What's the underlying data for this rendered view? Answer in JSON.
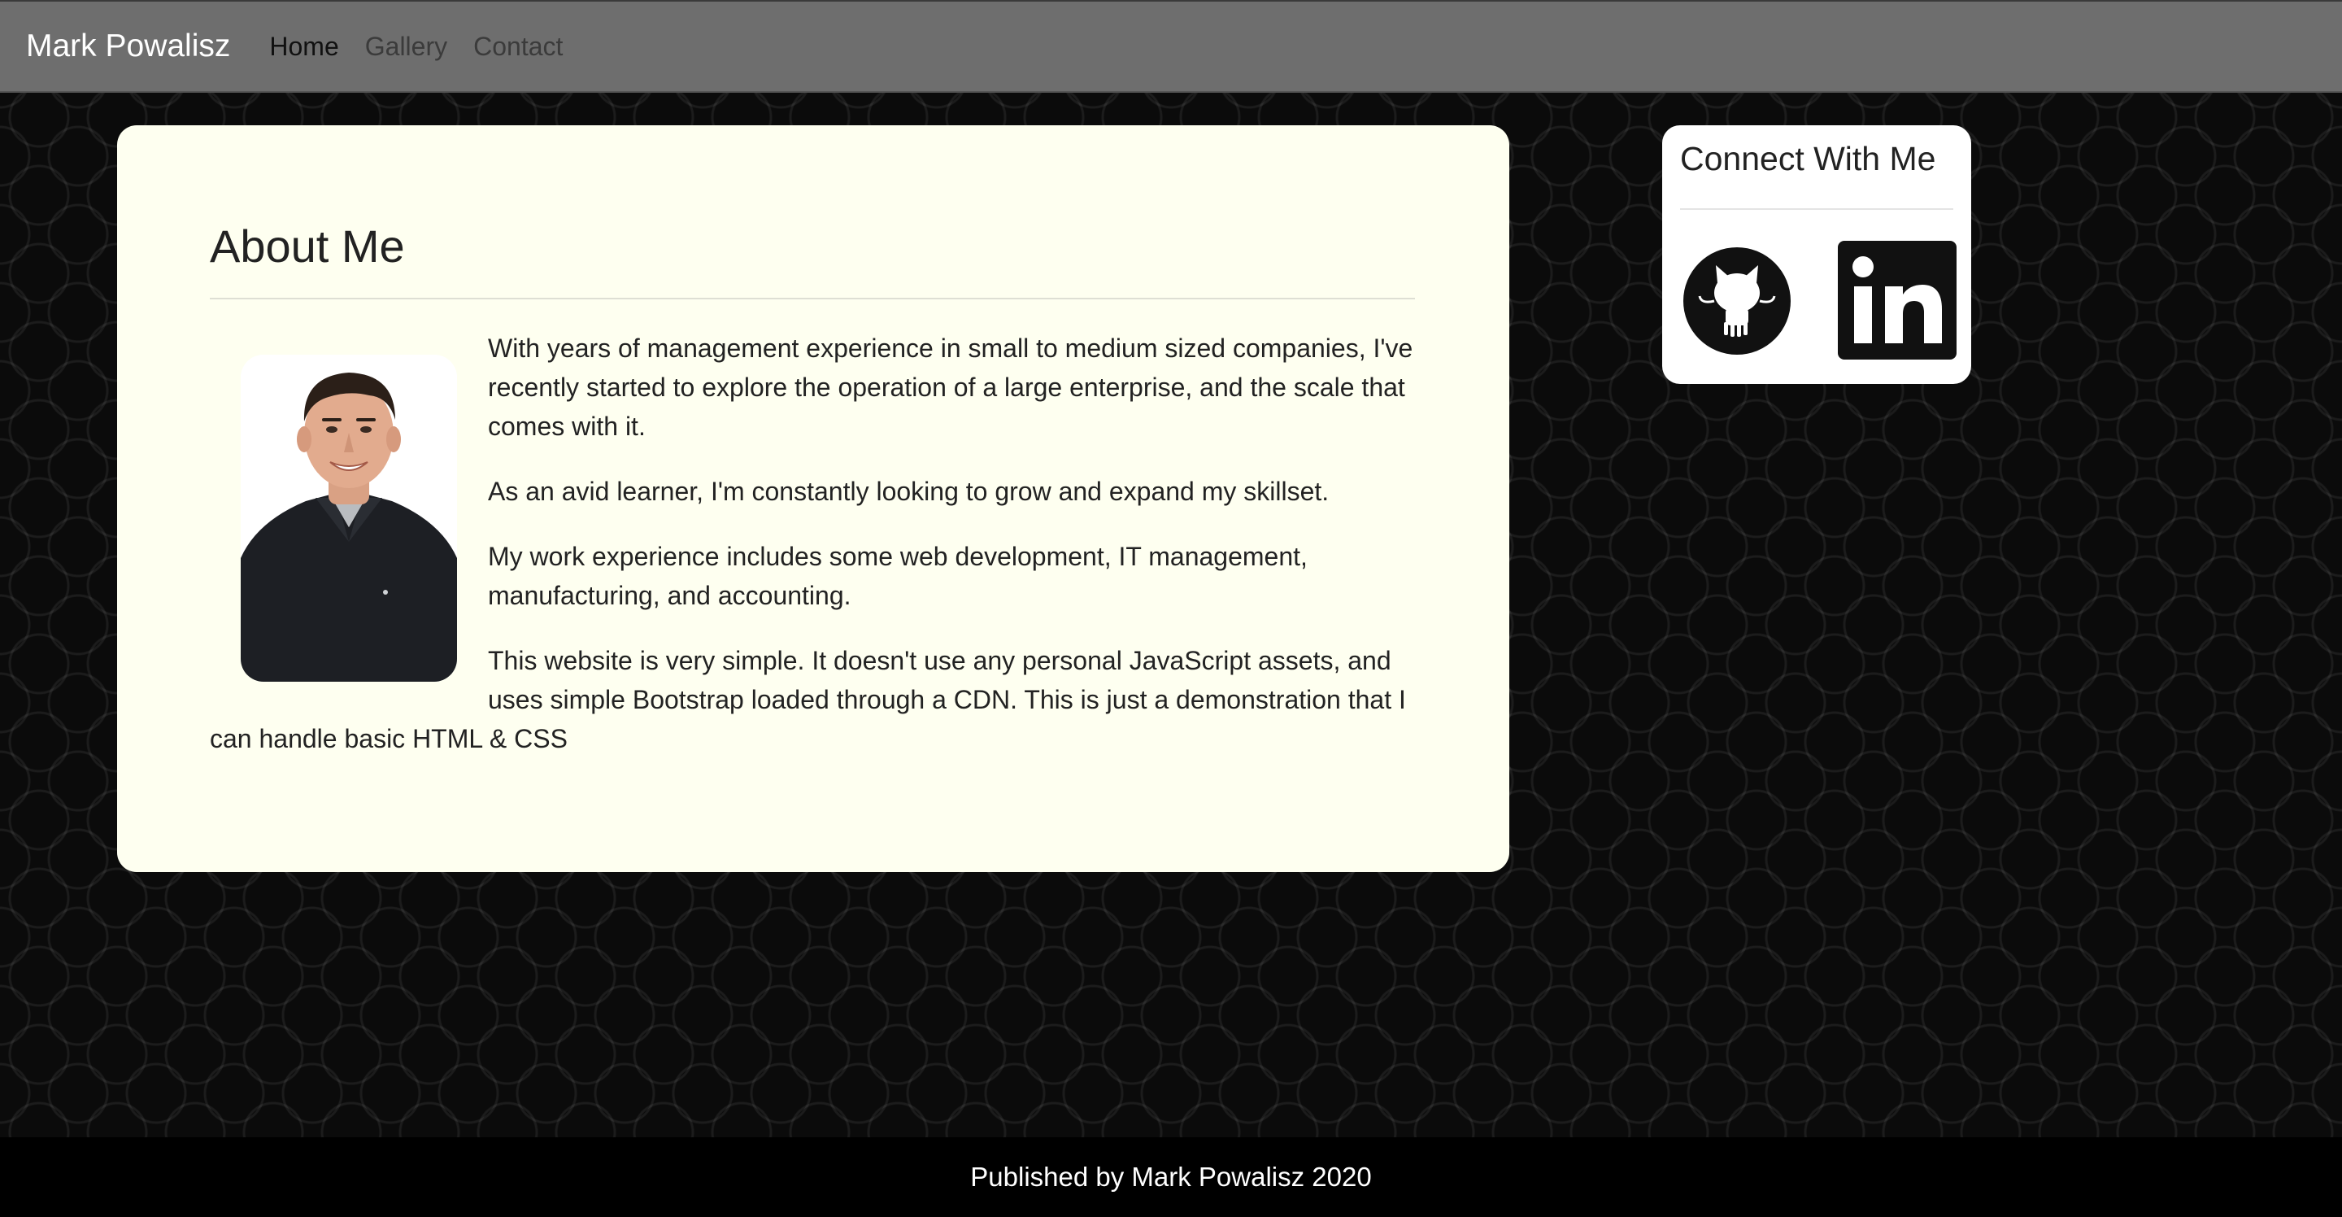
{
  "navbar": {
    "brand": "Mark Powalisz",
    "links": [
      {
        "label": "Home",
        "active": true
      },
      {
        "label": "Gallery",
        "active": false
      },
      {
        "label": "Contact",
        "active": false
      }
    ]
  },
  "about": {
    "title": "About Me",
    "paragraphs": [
      "With years of management experience in small to medium sized companies, I've recently started to explore the operation of a large enterprise, and the scale that comes with it.",
      "As an avid learner, I'm constantly looking to grow and expand my skillset.",
      "My work experience includes some web development, IT management, manufacturing, and accounting.",
      "This website is very simple. It doesn't use any personal JavaScript assets, and uses simple Bootstrap loaded through a CDN. This is just a demonstration that I can handle basic HTML & CSS"
    ]
  },
  "connect": {
    "title": "Connect With Me",
    "github_icon": "github-icon",
    "linkedin_icon": "linkedin-icon"
  },
  "footer": {
    "text": "Published by Mark Powalisz 2020"
  },
  "colors": {
    "navbar_bg": "#6e6e6e",
    "card_bg": "#fefff0",
    "page_bg": "#0b0b0b",
    "footer_bg": "#000000"
  }
}
